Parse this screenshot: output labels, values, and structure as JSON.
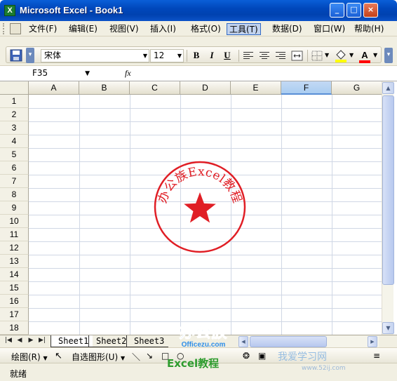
{
  "window": {
    "title": "Microsoft Excel - Book1",
    "app_icon_letter": "X",
    "controls": {
      "minimize": "_",
      "maximize": "□",
      "close": "×"
    }
  },
  "menu": {
    "items": [
      {
        "label": "文件(F)",
        "active": false
      },
      {
        "label": "编辑(E)",
        "active": false
      },
      {
        "label": "视图(V)",
        "active": false
      },
      {
        "label": "插入(I)",
        "active": false
      },
      {
        "label": "格式(O)",
        "active": false
      },
      {
        "label": "工具(T)",
        "active": true
      },
      {
        "label": "数据(D)",
        "active": false
      },
      {
        "label": "窗口(W)",
        "active": false
      },
      {
        "label": "帮助(H)",
        "active": false
      }
    ],
    "doc_controls": {
      "minimize": "-",
      "restore": "❐",
      "close": "×"
    }
  },
  "toolbar": {
    "font_name": "宋体",
    "font_size": "12",
    "bold_label": "B",
    "italic_label": "I",
    "underline_label": "U",
    "font_color_label": "A",
    "fill_color": "#ffff00",
    "font_color": "#ff0000"
  },
  "formula_bar": {
    "name_box": "F35",
    "fx_label": "fx",
    "content": ""
  },
  "sheet": {
    "columns": [
      "A",
      "B",
      "C",
      "D",
      "E",
      "F",
      "G"
    ],
    "selected_column": "F",
    "rows": [
      "1",
      "2",
      "3",
      "4",
      "5",
      "6",
      "7",
      "8",
      "9",
      "10",
      "11",
      "12",
      "13",
      "14",
      "15",
      "16",
      "17",
      "18"
    ]
  },
  "stamp": {
    "text": "办公族Excel教程",
    "color": "#e01e25"
  },
  "tabs": {
    "items": [
      "Sheet1",
      "Sheet2",
      "Sheet3"
    ],
    "active": "Sheet1"
  },
  "draw_toolbar": {
    "draw_label": "绘图(R)",
    "autoshapes_label": "自选图形(U)"
  },
  "status": {
    "text": "就绪"
  },
  "watermark": {
    "brand": "办公族",
    "domain": "Officezu.com",
    "tagline": "Excel教程",
    "site": "我爱学习网",
    "url": "www.52ij.com"
  }
}
